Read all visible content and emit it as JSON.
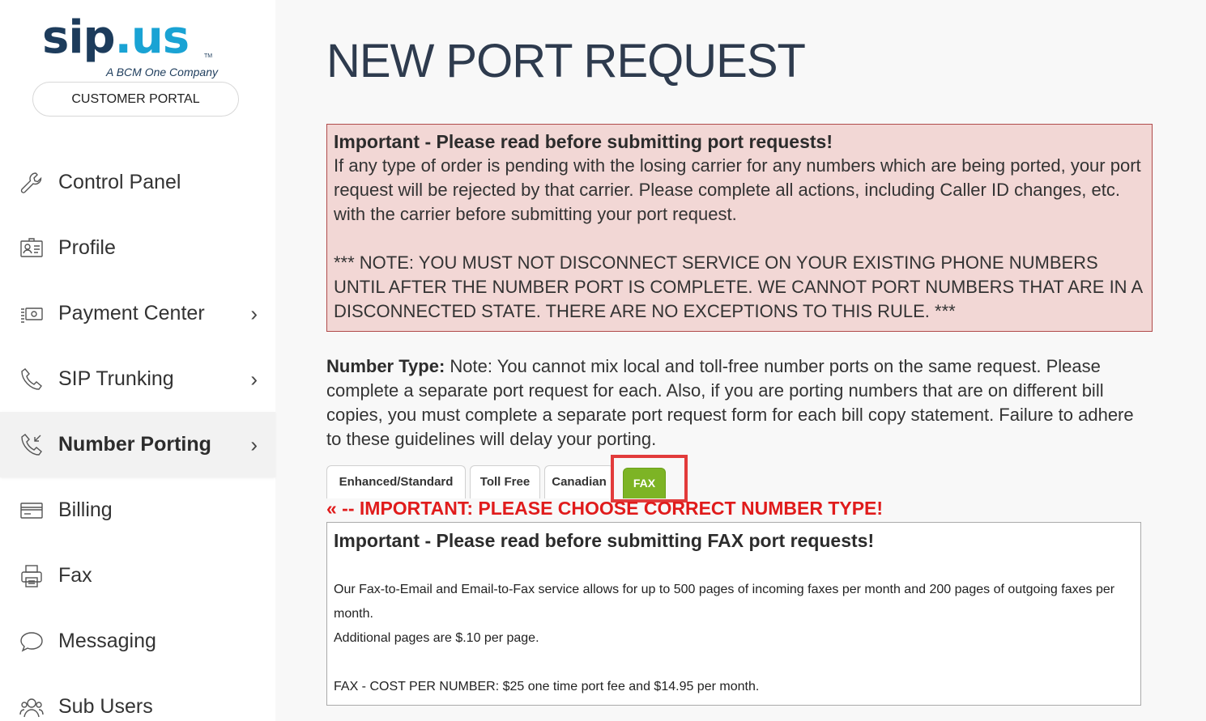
{
  "sidebar": {
    "logo": {
      "brand_sip": "sip",
      "brand_dot": ".",
      "brand_us": "us",
      "trademark": "TM",
      "tagline": "A BCM One Company"
    },
    "portal_label": "CUSTOMER PORTAL",
    "items": [
      {
        "label": "Control Panel",
        "icon": "wrench-icon",
        "has_chevron": false
      },
      {
        "label": "Profile",
        "icon": "id-card-icon",
        "has_chevron": false
      },
      {
        "label": "Payment Center",
        "icon": "money-icon",
        "has_chevron": true
      },
      {
        "label": "SIP Trunking",
        "icon": "phone-icon",
        "has_chevron": true
      },
      {
        "label": "Number Porting",
        "icon": "phone-incoming-icon",
        "has_chevron": true,
        "active": true
      },
      {
        "label": "Billing",
        "icon": "credit-card-icon",
        "has_chevron": false
      },
      {
        "label": "Fax",
        "icon": "fax-icon",
        "has_chevron": false
      },
      {
        "label": "Messaging",
        "icon": "chat-bubble-icon",
        "has_chevron": false
      },
      {
        "label": "Sub Users",
        "icon": "users-icon",
        "has_chevron": false
      }
    ],
    "chevron": "›"
  },
  "main": {
    "title": "NEW PORT REQUEST",
    "alert": {
      "title": "Important - Please read before submitting port requests!",
      "text": "If any type of order is pending with the losing carrier for any numbers which are being ported, your port request will be rejected by that carrier. Please complete all actions, including Caller ID changes, etc. with the carrier before submitting your port request.",
      "note": "*** NOTE: YOU MUST NOT DISCONNECT SERVICE ON YOUR EXISTING PHONE NUMBERS UNTIL AFTER THE NUMBER PORT IS COMPLETE. WE CANNOT PORT NUMBERS THAT ARE IN A DISCONNECTED STATE. THERE ARE NO EXCEPTIONS TO THIS RULE. ***"
    },
    "number_type": {
      "label": "Number Type:",
      "text": " Note: You cannot mix local and toll-free number ports on the same request. Please complete a separate port request for each. Also, if you are porting numbers that are on different bill copies, you must complete a separate port request form for each bill copy statement. Failure to adhere to these guidelines will delay your porting."
    },
    "tabs": [
      {
        "label": "Enhanced/Standard"
      },
      {
        "label": "Toll Free"
      },
      {
        "label": "Canadian"
      },
      {
        "label": "FAX",
        "active": true
      }
    ],
    "important_line": "« -- IMPORTANT: PLEASE CHOOSE CORRECT NUMBER TYPE!",
    "fax_box": {
      "title": "Important - Please read before submitting FAX port requests!",
      "p1": "Our Fax-to-Email and Email-to-Fax service allows for up to 500 pages of incoming faxes per month and 200 pages of outgoing faxes per month.",
      "p2": "Additional pages are $.10 per page.",
      "cost": "FAX - COST PER NUMBER: $25 one time port fee and $14.95 per month."
    }
  },
  "colors": {
    "brand_dark": "#1d3c5c",
    "brand_light": "#1aa3d4",
    "alert_bg": "#f2d7d5",
    "alert_border": "#b04b4b",
    "fax_tab": "#7db425",
    "highlight": "#e23b3b",
    "important_red": "#e01b1b"
  }
}
